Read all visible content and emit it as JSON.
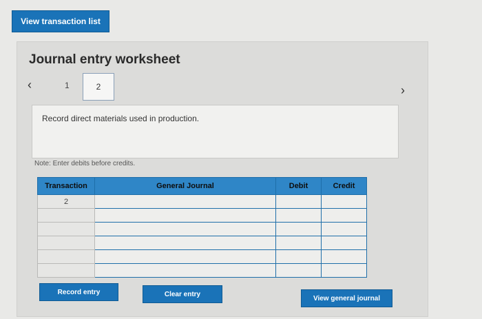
{
  "top_button": {
    "label": "View transaction list"
  },
  "worksheet": {
    "title": "Journal entry worksheet",
    "nav": {
      "prev_icon": "chevron-left-icon",
      "next_icon": "chevron-right-icon"
    },
    "steps": [
      "1",
      "2"
    ],
    "current_step": "2",
    "description": "Record direct materials used in production.",
    "note": "Note: Enter debits before credits."
  },
  "table": {
    "headers": [
      "Transaction",
      "General Journal",
      "Debit",
      "Credit"
    ],
    "rows": [
      {
        "transaction": "2",
        "account": "",
        "debit": "",
        "credit": ""
      },
      {
        "transaction": "",
        "account": "",
        "debit": "",
        "credit": ""
      },
      {
        "transaction": "",
        "account": "",
        "debit": "",
        "credit": ""
      },
      {
        "transaction": "",
        "account": "",
        "debit": "",
        "credit": ""
      },
      {
        "transaction": "",
        "account": "",
        "debit": "",
        "credit": ""
      },
      {
        "transaction": "",
        "account": "",
        "debit": "",
        "credit": ""
      }
    ]
  },
  "buttons": {
    "record": "Record entry",
    "clear": "Clear entry",
    "view_journal": "View general journal"
  },
  "colors": {
    "accent": "#1a73b8",
    "header": "#2f86c7"
  }
}
